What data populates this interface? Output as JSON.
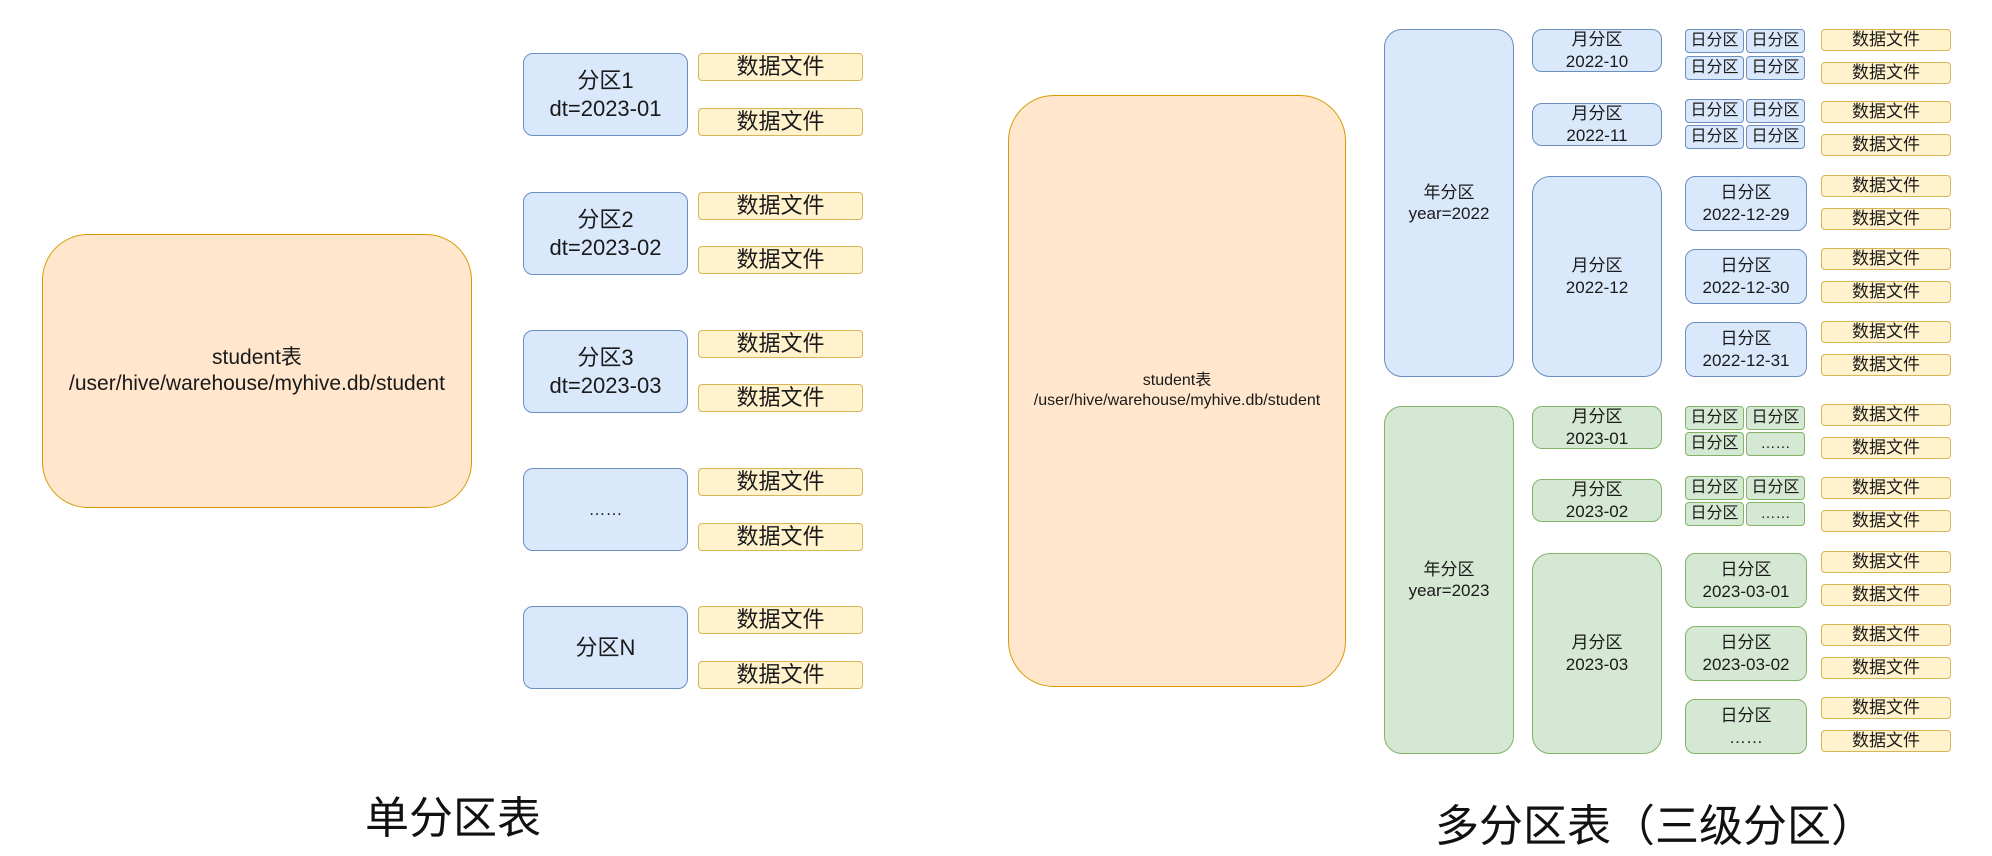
{
  "single": {
    "caption": "单分区表",
    "table_label": "student表",
    "table_path": "/user/hive/warehouse/myhive.db/student",
    "file_label": "数据文件",
    "partitions": [
      {
        "line1": "分区1",
        "line2": "dt=2023-01"
      },
      {
        "line1": "分区2",
        "line2": "dt=2023-02"
      },
      {
        "line1": "分区3",
        "line2": "dt=2023-03"
      },
      {
        "line1": "……",
        "line2": ""
      },
      {
        "line1": "分区N",
        "line2": ""
      }
    ]
  },
  "multi": {
    "caption": "多分区表（三级分区）",
    "table_label": "student表",
    "table_path": "/user/hive/warehouse/myhive.db/student",
    "file_label": "数据文件",
    "day_cell": "日分区",
    "ellipsis": "……",
    "years": [
      {
        "line1": "年分区",
        "line2": "year=2022"
      },
      {
        "line1": "年分区",
        "line2": "year=2023"
      }
    ],
    "months": [
      {
        "line1": "月分区",
        "line2": "2022-10"
      },
      {
        "line1": "月分区",
        "line2": "2022-11"
      },
      {
        "line1": "月分区",
        "line2": "2022-12"
      },
      {
        "line1": "月分区",
        "line2": "2023-01"
      },
      {
        "line1": "月分区",
        "line2": "2023-02"
      },
      {
        "line1": "月分区",
        "line2": "2023-03"
      }
    ],
    "days": [
      {
        "line1": "日分区",
        "line2": "2022-12-29"
      },
      {
        "line1": "日分区",
        "line2": "2022-12-30"
      },
      {
        "line1": "日分区",
        "line2": "2022-12-31"
      },
      {
        "line1": "日分区",
        "line2": "2023-03-01"
      },
      {
        "line1": "日分区",
        "line2": "2023-03-02"
      },
      {
        "line1": "日分区",
        "line2": "……"
      }
    ]
  }
}
